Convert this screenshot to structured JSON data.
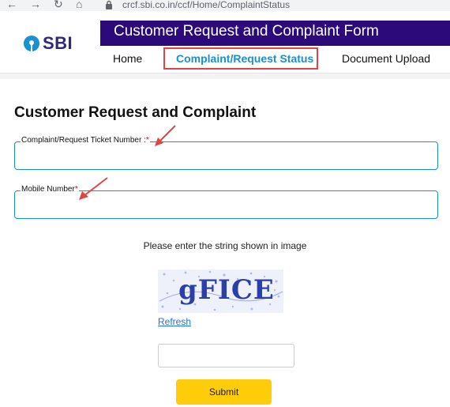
{
  "browser": {
    "url": "crcf.sbi.co.in/ccf/Home/ComplaintStatus",
    "back_icon": "arrow-left-icon",
    "forward_icon": "arrow-right-icon",
    "reload_icon": "reload-icon",
    "home_icon": "home-icon",
    "lock_icon": "lock-icon"
  },
  "header": {
    "logo_text": "SBI",
    "title": "Customer Request and Complaint Form",
    "nav": [
      {
        "label": "Home"
      },
      {
        "label": "Complaint/Request Status",
        "active": true
      },
      {
        "label": "Document Upload"
      }
    ]
  },
  "form": {
    "title": "Customer Request and Complaint",
    "ticket_label": "Complaint/Request Ticket Number :",
    "ticket_required": "*",
    "ticket_value": "",
    "mobile_label": "Mobile Number",
    "mobile_required": "*",
    "mobile_value": "",
    "captcha_prompt": "Please enter the string shown in image",
    "captcha_text": "gFICE",
    "refresh_label": "Refresh",
    "captcha_value": "",
    "submit_label": "Submit"
  },
  "colors": {
    "title_band": "#2c0a7a",
    "accent": "#1a8fd1",
    "highlight_border": "#e04444",
    "submit": "#ffcc0a",
    "annotation_arrow": "#e04444"
  }
}
